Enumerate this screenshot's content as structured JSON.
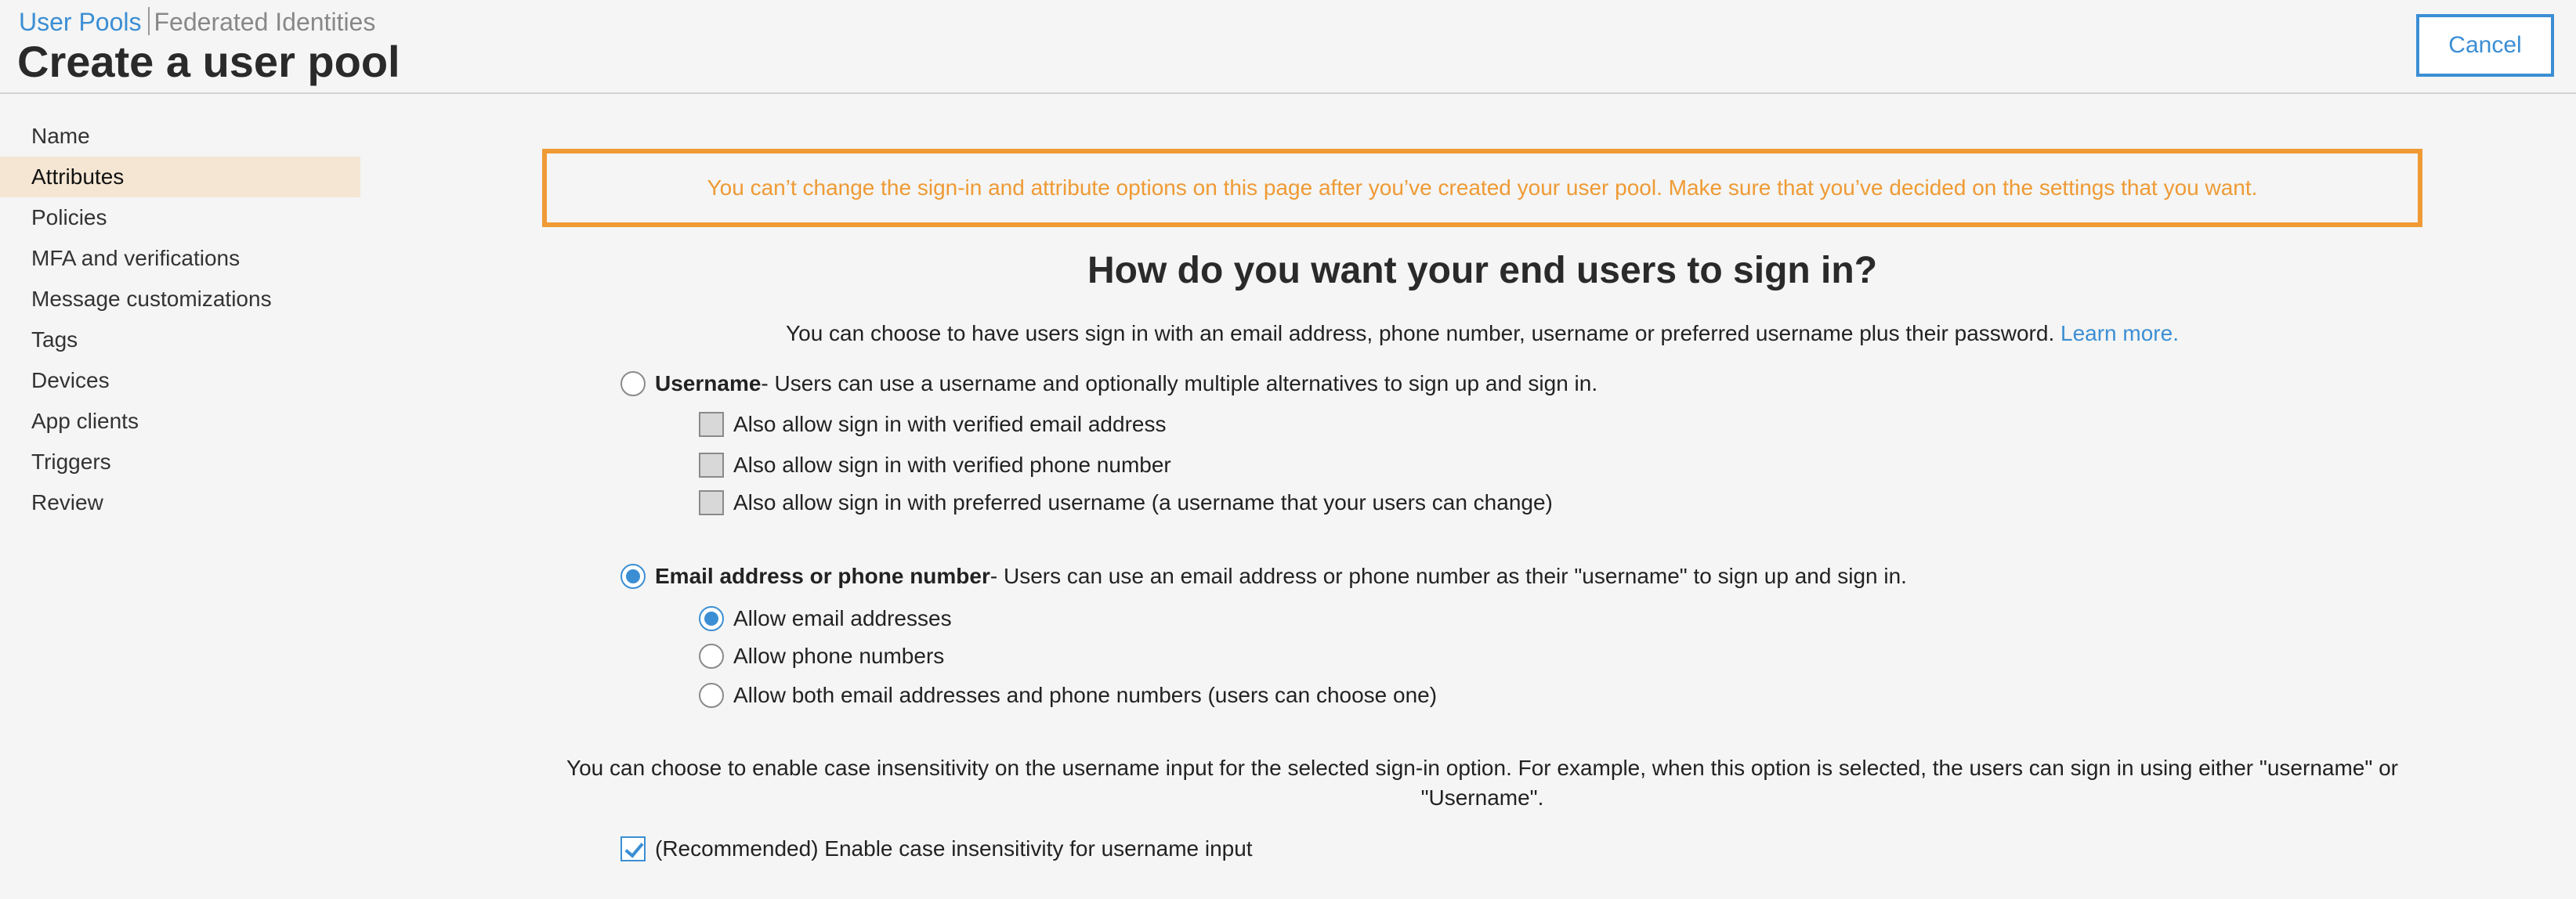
{
  "header": {
    "crumbs": {
      "active": "User Pools",
      "other": "Federated Identities"
    },
    "title": "Create a user pool",
    "cancel_label": "Cancel"
  },
  "sidebar": {
    "items": [
      {
        "label": "Name"
      },
      {
        "label": "Attributes"
      },
      {
        "label": "Policies"
      },
      {
        "label": "MFA and verifications"
      },
      {
        "label": "Message customizations"
      },
      {
        "label": "Tags"
      },
      {
        "label": "Devices"
      },
      {
        "label": "App clients"
      },
      {
        "label": "Triggers"
      },
      {
        "label": "Review"
      }
    ],
    "active_label": "Attributes"
  },
  "main": {
    "warning": "You can’t change the sign-in and attribute options on this page after you’ve created your user pool. Make sure that you’ve decided on the settings that you want.",
    "heading": "How do you want your end users to sign in?",
    "intro": "You can choose to have users sign in with an email address, phone number, username or preferred username plus their password.",
    "learn_more": "Learn more.",
    "username_option": {
      "title": "Username",
      "desc": " - Users can use a username and optionally multiple alternatives to sign up and sign in.",
      "checked": false,
      "sub": [
        {
          "label": "Also allow sign in with verified email address",
          "checked": false
        },
        {
          "label": "Also allow sign in with verified phone number",
          "checked": false
        },
        {
          "label": "Also allow sign in with preferred username (a username that your users can change)",
          "checked": false
        }
      ]
    },
    "email_option": {
      "title": "Email address or phone number",
      "desc": " - Users can use an email address or phone number as their \"username\" to sign up and sign in.",
      "checked": true,
      "sub": [
        {
          "label": "Allow email addresses",
          "checked": true
        },
        {
          "label": "Allow phone numbers",
          "checked": false
        },
        {
          "label": "Allow both email addresses and phone numbers (users can choose one)",
          "checked": false
        }
      ]
    },
    "case_note": "You can choose to enable case insensitivity on the username input for the selected sign-in option. For example, when this option is selected, the users can sign in using either \"username\" or \"Username\".",
    "case_option": {
      "label": "(Recommended) Enable case insensitivity for username input",
      "checked": true
    }
  },
  "colors": {
    "accent": "#3b8ed4",
    "warning": "#ef9a35",
    "active_bg": "#f5e6d4"
  }
}
